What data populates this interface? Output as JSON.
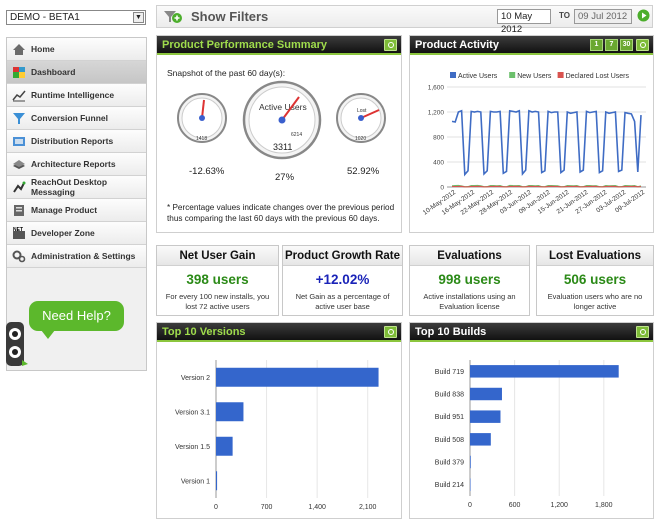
{
  "app_selector": {
    "value": "DEMO - BETA1"
  },
  "sidebar": {
    "items": [
      {
        "label": "Home",
        "icon": "home-icon"
      },
      {
        "label": "Dashboard",
        "icon": "dashboard-icon",
        "active": true
      },
      {
        "label": "Runtime Intelligence",
        "icon": "line-chart-icon"
      },
      {
        "label": "Conversion Funnel",
        "icon": "funnel-icon"
      },
      {
        "label": "Distribution Reports",
        "icon": "distribution-icon"
      },
      {
        "label": "Architecture Reports",
        "icon": "architecture-icon"
      },
      {
        "label": "ReachOut Desktop Messaging",
        "icon": "reachout-icon"
      },
      {
        "label": "Manage Product",
        "icon": "manage-icon"
      },
      {
        "label": "Developer Zone",
        "icon": "developer-icon"
      },
      {
        "label": "Administration & Settings",
        "icon": "gears-icon"
      }
    ],
    "help_label": "Need Help?"
  },
  "filterbar": {
    "title": "Show Filters",
    "from_date": "10 May 2012",
    "to_label": "TO",
    "to_date": "09 Jul 2012"
  },
  "performance": {
    "title": "Product Performance Summary",
    "snapshot": "Snapshot of the past 60 day(s):",
    "gauges": [
      {
        "label": "",
        "value": "1418",
        "percent": "-12.63%"
      },
      {
        "label": "Active Users",
        "value": "3311",
        "sub": "6214",
        "percent": "27%"
      },
      {
        "label": "Lost",
        "value": "1020",
        "percent": "52.92%"
      }
    ],
    "note": "* Percentage values indicate changes over the previous period thus comparing the last 60 days with the previous 60 days."
  },
  "activity": {
    "title": "Product Activity",
    "ranges": [
      "1",
      "7",
      "30"
    ]
  },
  "stats": [
    {
      "title": "Net User Gain",
      "value": "398 users",
      "desc": "For every 100 new installs, you lost 72 active users",
      "color": "#2b8a17"
    },
    {
      "title": "Product Growth Rate",
      "value": "+12.02%",
      "desc": "Net Gain as a percentage of active user base",
      "color": "#1a23b8"
    },
    {
      "title": "Evaluations",
      "value": "998 users",
      "desc": "Active installations using an Evaluation license",
      "color": "#2b8a17"
    },
    {
      "title": "Lost Evaluations",
      "value": "506 users",
      "desc": "Evaluation users who are no longer active",
      "color": "#2b8a17"
    }
  ],
  "versions": {
    "title": "Top 10 Versions"
  },
  "builds": {
    "title": "Top 10 Builds"
  },
  "colors": {
    "accent": "#8cc63e",
    "bar": "#3466cc",
    "active": "#3f6cc4",
    "new": "#6cc06c",
    "lost": "#d9534f"
  },
  "chart_data": [
    {
      "type": "line",
      "title": "Product Activity",
      "x": [
        "10-May-2012",
        "16-May-2012",
        "22-May-2012",
        "28-May-2012",
        "03-Jun-2012",
        "09-Jun-2012",
        "15-Jun-2012",
        "21-Jun-2012",
        "27-Jun-2012",
        "03-Jul-2012",
        "09-Jul-2012"
      ],
      "ylim": [
        0,
        1600
      ],
      "yticks": [
        "0",
        "400",
        "800",
        "1,200",
        "1,600"
      ],
      "series": [
        {
          "name": "Active Users",
          "values": [
            1050,
            1040,
            1200,
            1220,
            200,
            260,
            1210,
            1200,
            1210,
            1200,
            210,
            260,
            1210,
            1200,
            1200,
            1210,
            220,
            250,
            1220,
            1210,
            1200,
            1220,
            210,
            270,
            1220,
            1200,
            1210,
            1200,
            230,
            260,
            1210,
            1190,
            1200,
            1200,
            230,
            270,
            1200,
            1180,
            1190,
            1200,
            240,
            270,
            1210,
            1190,
            1200,
            1210,
            230,
            260,
            1200,
            1180,
            1190,
            1200,
            250,
            270,
            1190,
            1180,
            1170,
            1050,
            240,
            1150
          ]
        },
        {
          "name": "New Users",
          "values": [
            20,
            22,
            25,
            18,
            5,
            6,
            24,
            22,
            26,
            20,
            5,
            7,
            22,
            24,
            20,
            22,
            6,
            5,
            25,
            22,
            21,
            23,
            5,
            6,
            22,
            24,
            20,
            22,
            6,
            5,
            24,
            22,
            21,
            20,
            5,
            6,
            22,
            21,
            20,
            22,
            5,
            6,
            24,
            22,
            20,
            21,
            6,
            5,
            22,
            20,
            21,
            22,
            5,
            6,
            22,
            21,
            20,
            22,
            6,
            18
          ]
        },
        {
          "name": "Declared Lost Users",
          "values": [
            10,
            8,
            9,
            12,
            2,
            3,
            10,
            9,
            11,
            10,
            2,
            3,
            9,
            10,
            11,
            10,
            3,
            2,
            10,
            9,
            12,
            10,
            2,
            3,
            11,
            10,
            9,
            10,
            3,
            2,
            10,
            11,
            9,
            10,
            2,
            3,
            10,
            9,
            10,
            11,
            2,
            3,
            9,
            10,
            11,
            10,
            3,
            2,
            10,
            9,
            11,
            10,
            2,
            3,
            10,
            9,
            10,
            11,
            3,
            8
          ]
        }
      ],
      "legend": "top"
    },
    {
      "type": "bar",
      "title": "Top 10 Versions",
      "orientation": "horizontal",
      "categories": [
        "Version 2",
        "Version 3.1",
        "Version 1.5",
        "Version 1"
      ],
      "values": [
        2250,
        380,
        230,
        15
      ],
      "xlim": [
        0,
        2450
      ],
      "xticks": [
        "0",
        "700",
        "1,400",
        "2,100"
      ]
    },
    {
      "type": "bar",
      "title": "Top 10 Builds",
      "orientation": "horizontal",
      "categories": [
        "Build 719",
        "Build 838",
        "Build 951",
        "Build 508",
        "Build 379",
        "Build 214"
      ],
      "values": [
        2000,
        430,
        410,
        280,
        10,
        0
      ],
      "xlim": [
        0,
        2300
      ],
      "xticks": [
        "0",
        "600",
        "1,200",
        "1,800"
      ]
    }
  ]
}
